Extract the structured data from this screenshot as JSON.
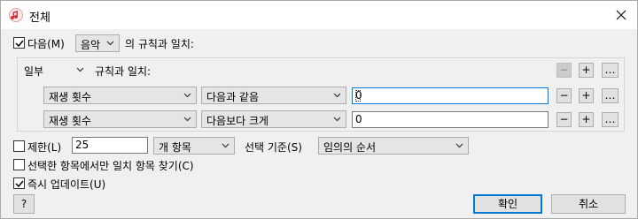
{
  "window": {
    "title": "전체"
  },
  "top_row": {
    "match_checked": true,
    "match_label": "다음(M)",
    "media_value": "음악",
    "rule_suffix": "의 규칙과 일치:"
  },
  "group": {
    "mode_value": "일부",
    "mode_suffix": "규칙과 일치:",
    "rules": [
      {
        "field": "재생 횟수",
        "operator": "다음과 같음",
        "value": "0"
      },
      {
        "field": "재생 횟수",
        "operator": "다음보다 크게",
        "value": "0"
      }
    ],
    "remove_label": "−",
    "add_label": "+",
    "more_label": "…"
  },
  "limit": {
    "checked": false,
    "label": "제한(L)",
    "value": "25",
    "unit_value": "개 항목",
    "selected_by_label": "선택 기준(S)",
    "selected_by_value": "임의의 순서"
  },
  "options": [
    {
      "label": "선택한 항목에서만 일치 항목 찾기(C)",
      "checked": false
    },
    {
      "label": "즉시 업데이트(U)",
      "checked": true
    }
  ],
  "buttons": {
    "help": "?",
    "ok": "확인",
    "cancel": "취소"
  },
  "icons": {
    "app": "music-note-icon",
    "close": "close-icon",
    "dropdown": "chevron-down-icon",
    "check": "check-icon"
  },
  "colors": {
    "accent": "#0078d7",
    "background": "#f0f0f0"
  }
}
